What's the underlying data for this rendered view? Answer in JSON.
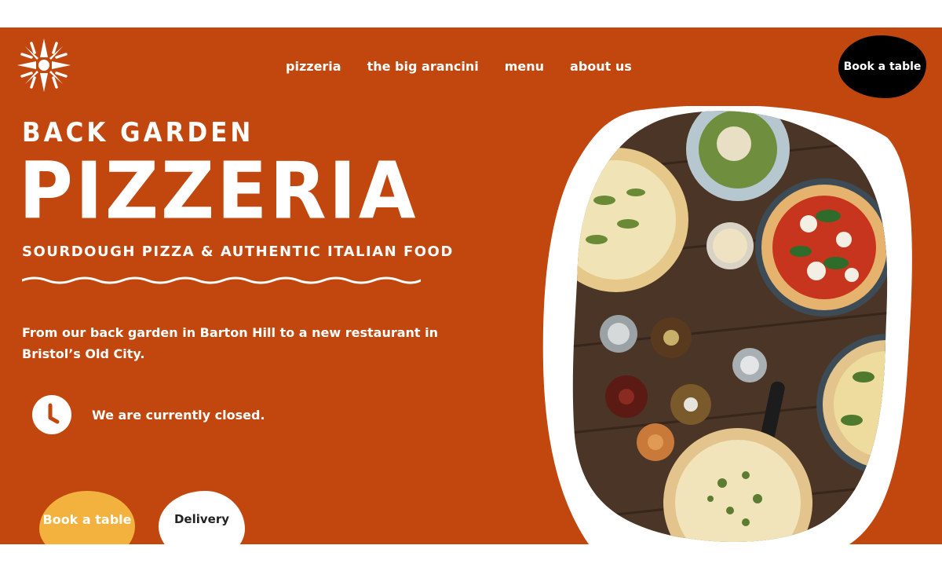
{
  "header": {
    "logo_icon": "starburst-logo-icon",
    "nav": [
      {
        "label": "pizzeria"
      },
      {
        "label": "the big arancini"
      },
      {
        "label": "menu"
      },
      {
        "label": "about us"
      }
    ],
    "book_button": "Book a table"
  },
  "hero": {
    "kicker": "BACK GARDEN",
    "title": "PIZZERIA",
    "tagline": "SOURDOUGH PIZZA & AUTHENTIC ITALIAN FOOD",
    "intro": "From our back garden in Barton Hill to a new restaurant in Bristol’s Old City.",
    "status_icon": "clock-icon",
    "status": "We are currently closed.",
    "book_button": "Book a table",
    "delivery_button": "Delivery",
    "image_subject": "overhead photo of pizzas and condiments on a wooden table"
  },
  "colors": {
    "brand_orange": "#c2470f",
    "accent_yellow": "#f2b23d",
    "black": "#000000",
    "white": "#ffffff"
  }
}
